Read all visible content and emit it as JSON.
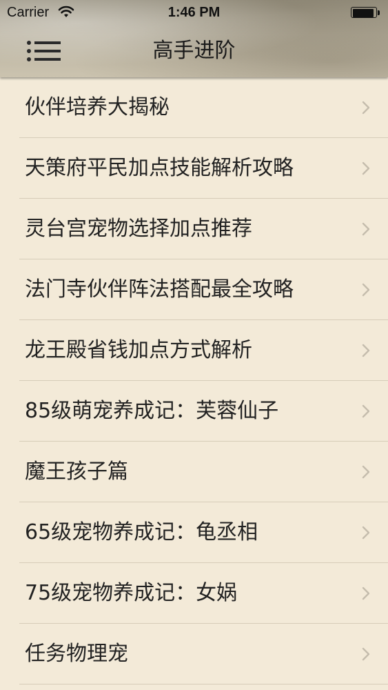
{
  "status_bar": {
    "carrier": "Carrier",
    "time": "1:46 PM",
    "battery_level": 0.95,
    "wifi_icon": "wifi-icon",
    "battery_icon": "battery-icon"
  },
  "nav": {
    "title": "高手进阶",
    "menu_icon": "menu-icon"
  },
  "list": {
    "chevron_icon": "chevron-right-icon",
    "items": [
      {
        "label": "伙伴培养大揭秘"
      },
      {
        "label": "天策府平民加点技能解析攻略"
      },
      {
        "label": "灵台宫宠物选择加点推荐"
      },
      {
        "label": "法门寺伙伴阵法搭配最全攻略"
      },
      {
        "label": "龙王殿省钱加点方式解析"
      },
      {
        "label": "85级萌宠养成记：芙蓉仙子"
      },
      {
        "label": "魔王孩子篇"
      },
      {
        "label": "65级宠物养成记：龟丞相"
      },
      {
        "label": "75级宠物养成记：女娲"
      },
      {
        "label": "任务物理宠"
      }
    ]
  },
  "colors": {
    "background": "#f3ead8",
    "separator": "#d6ccb8",
    "text": "#222222",
    "chevron": "#c4bcad"
  }
}
